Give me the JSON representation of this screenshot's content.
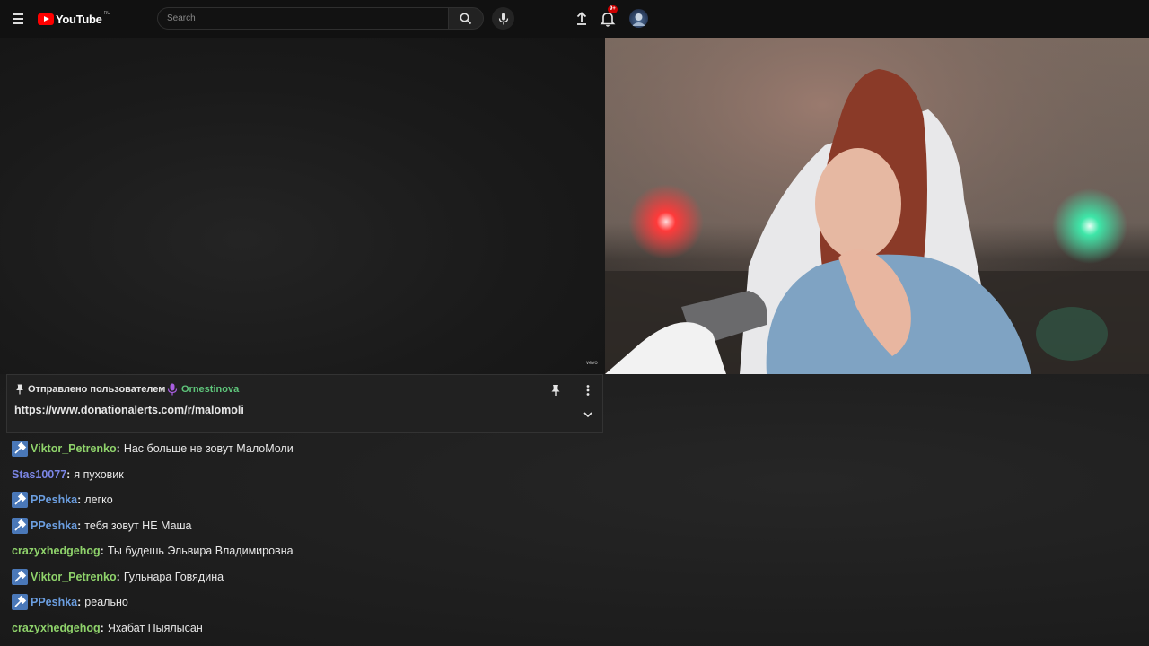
{
  "header": {
    "logo_text": "YouTube",
    "logo_region": "RU",
    "search_placeholder": "Search",
    "notification_count": "9+",
    "icons": [
      "menu-icon",
      "search-icon",
      "microphone-icon",
      "upload-icon",
      "bell-icon"
    ]
  },
  "video": {
    "watermark": "vevo"
  },
  "pinned": {
    "label": "Отправлено пользователем",
    "user": "Ornestinova",
    "user_color": "#5ec47a",
    "link": "https://www.donationalerts.com/r/malomoli"
  },
  "chat": {
    "messages": [
      {
        "user": "Viktor_Petrenko",
        "text": "Нас больше не зовут МалоМоли",
        "color": "#8fd36b",
        "badge": true
      },
      {
        "user": "Stas10077",
        "text": "я пуховик",
        "color": "#7b86e6",
        "badge": false
      },
      {
        "user": "PPeshka",
        "text": "легко",
        "color": "#6b9ee0",
        "badge": true
      },
      {
        "user": "PPeshka",
        "text": "тебя зовут НЕ Маша",
        "color": "#6b9ee0",
        "badge": true
      },
      {
        "user": "crazyxhedgehog",
        "text": "Ты будешь Эльвира Владимировна",
        "color": "#8fd36b",
        "badge": false
      },
      {
        "user": "Viktor_Petrenko",
        "text": "Гульнара Говядина",
        "color": "#8fd36b",
        "badge": true
      },
      {
        "user": "PPeshka",
        "text": "реально",
        "color": "#6b9ee0",
        "badge": true
      },
      {
        "user": "crazyxhedgehog",
        "text": "Яхабат Пыялысан",
        "color": "#8fd36b",
        "badge": false
      }
    ]
  },
  "colors": {
    "accent_red": "#ff0000",
    "mod_badge": "#4a78b8"
  }
}
